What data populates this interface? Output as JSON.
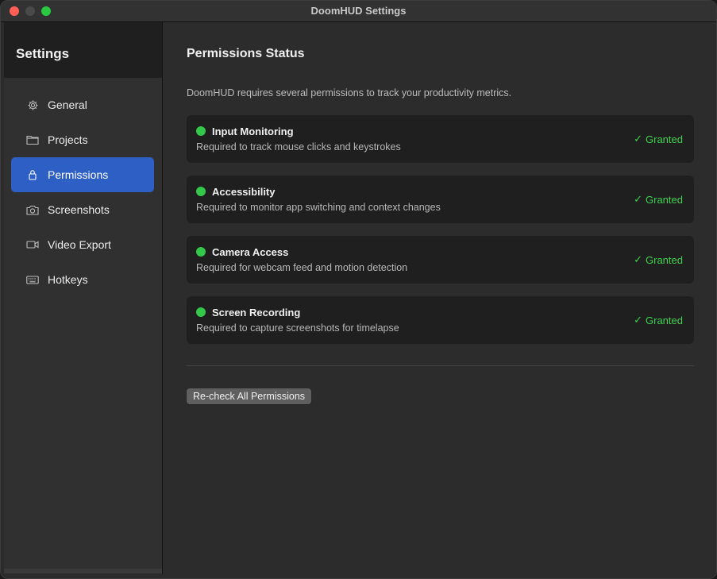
{
  "window": {
    "title": "DoomHUD Settings"
  },
  "colors": {
    "accent": "#2d5fc4",
    "granted": "#3fd14f",
    "status_dot": "#34c84a",
    "traffic_close": "#ff5f57",
    "traffic_minimize": "#4a4a4a",
    "traffic_zoom": "#28c840"
  },
  "sidebar": {
    "title": "Settings",
    "items": [
      {
        "label": "General",
        "icon": "gear-icon",
        "active": false
      },
      {
        "label": "Projects",
        "icon": "folder-icon",
        "active": false
      },
      {
        "label": "Permissions",
        "icon": "lock-icon",
        "active": true
      },
      {
        "label": "Screenshots",
        "icon": "camera-icon",
        "active": false
      },
      {
        "label": "Video Export",
        "icon": "video-icon",
        "active": false
      },
      {
        "label": "Hotkeys",
        "icon": "keyboard-icon",
        "active": false
      }
    ]
  },
  "main": {
    "title": "Permissions Status",
    "description": "DoomHUD requires several permissions to track your productivity metrics.",
    "permissions": [
      {
        "name": "Input Monitoring",
        "description": "Required to track mouse clicks and keystrokes",
        "status": "Granted"
      },
      {
        "name": "Accessibility",
        "description": "Required to monitor app switching and context changes",
        "status": "Granted"
      },
      {
        "name": "Camera Access",
        "description": "Required for webcam feed and motion detection",
        "status": "Granted"
      },
      {
        "name": "Screen Recording",
        "description": "Required to capture screenshots for timelapse",
        "status": "Granted"
      }
    ],
    "recheck_label": "Re-check All Permissions"
  }
}
